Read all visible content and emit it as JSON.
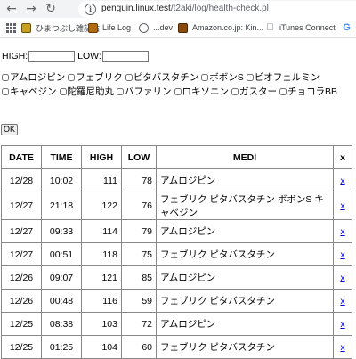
{
  "browser": {
    "url_domain": "penguin.linux.test",
    "url_path": "/t2aki/log/health-check.pl",
    "bookmarks": [
      {
        "label": "ひまつぶし雑記帖",
        "icon": "himatsubushi-favicon"
      },
      {
        "label": "Life Log",
        "icon": "lifelog-favicon"
      },
      {
        "label": "...dev",
        "icon": "globe-icon"
      },
      {
        "label": "Amazon.co.jp: Kin...",
        "icon": "amazon-favicon"
      },
      {
        "label": "iTunes Connect",
        "icon": "apple-icon"
      },
      {
        "label": "G",
        "icon": "google-icon"
      }
    ]
  },
  "form": {
    "high_label": "HIGH:",
    "low_label": "LOW:",
    "high_value": "",
    "low_value": "",
    "medications": [
      "アムロジピン",
      "フェブリク",
      "ピタバスタチン",
      "ボボンS",
      "ビオフェルミン",
      "キャベジン",
      "陀羅尼助丸",
      "バファリン",
      "ロキソニン",
      "ガスター",
      "チョコラBB"
    ],
    "ok_label": "OK"
  },
  "table": {
    "headers": [
      "DATE",
      "TIME",
      "HIGH",
      "LOW",
      "MEDI",
      "x"
    ],
    "rows": [
      {
        "date": "12/28",
        "time": "10:02",
        "high": "111",
        "low": "78",
        "medi": "アムロジピン",
        "x": "x"
      },
      {
        "date": "12/27",
        "time": "21:18",
        "high": "122",
        "low": "76",
        "medi": "フェブリク ピタバスタチン ボボンS キャベジン",
        "x": "x"
      },
      {
        "date": "12/27",
        "time": "09:33",
        "high": "114",
        "low": "79",
        "medi": "アムロジピン",
        "x": "x"
      },
      {
        "date": "12/27",
        "time": "00:51",
        "high": "118",
        "low": "75",
        "medi": "フェブリク ピタバスタチン",
        "x": "x"
      },
      {
        "date": "12/26",
        "time": "09:07",
        "high": "121",
        "low": "85",
        "medi": "アムロジピン",
        "x": "x"
      },
      {
        "date": "12/26",
        "time": "00:48",
        "high": "116",
        "low": "59",
        "medi": "フェブリク ピタバスタチン",
        "x": "x"
      },
      {
        "date": "12/25",
        "time": "08:38",
        "high": "103",
        "low": "72",
        "medi": "アムロジピン",
        "x": "x"
      },
      {
        "date": "12/25",
        "time": "01:25",
        "high": "104",
        "low": "60",
        "medi": "フェブリク ピタバスタチン",
        "x": "x"
      }
    ]
  }
}
